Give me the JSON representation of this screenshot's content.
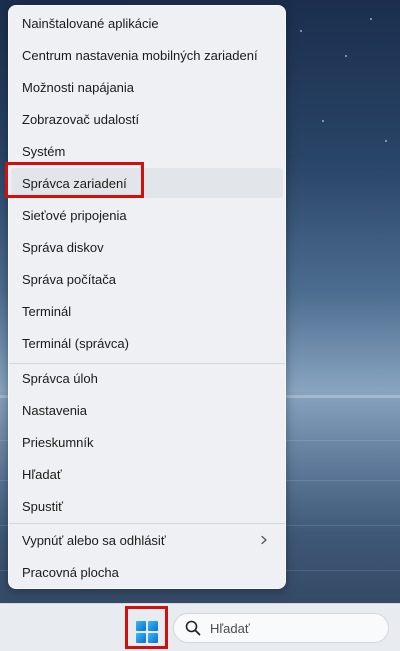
{
  "menu": {
    "items": [
      {
        "label": "Nainštalované aplikácie"
      },
      {
        "label": "Centrum nastavenia mobilných zariadení"
      },
      {
        "label": "Možnosti napájania"
      },
      {
        "label": "Zobrazovač udalostí"
      },
      {
        "label": "Systém"
      },
      {
        "label": "Správca zariadení"
      },
      {
        "label": "Sieťové pripojenia"
      },
      {
        "label": "Správa diskov"
      },
      {
        "label": "Správa počítača"
      },
      {
        "label": "Terminál"
      },
      {
        "label": "Terminál (správca)"
      },
      {
        "label": "Správca úloh"
      },
      {
        "label": "Nastavenia"
      },
      {
        "label": "Prieskumník"
      },
      {
        "label": "Hľadať"
      },
      {
        "label": "Spustiť"
      },
      {
        "label": "Vypnúť alebo sa odhlásiť"
      },
      {
        "label": "Pracovná plocha"
      }
    ]
  },
  "taskbar": {
    "search_placeholder": "Hľadať",
    "start_icon": "windows-logo-icon",
    "search_icon": "search-icon"
  },
  "colors": {
    "highlight": "#d20f0f",
    "menu_bg": "#eef0f3",
    "win_blue": "#0a6fd4"
  }
}
